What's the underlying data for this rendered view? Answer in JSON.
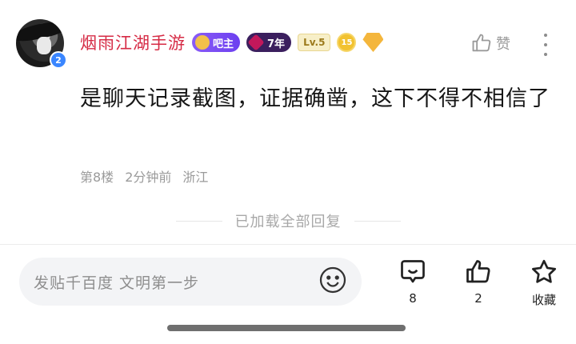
{
  "post": {
    "username": "烟雨江湖手游",
    "avatar_level": "2",
    "badges": {
      "owner": "吧主",
      "years": "7年",
      "level": "Lv.5",
      "coin": "15"
    },
    "like_label": "赞",
    "content": "是聊天记录截图，证据确凿，这下不得不相信了",
    "floor": "第8楼",
    "time": "2分钟前",
    "location": "浙江"
  },
  "loaded_text": "已加载全部回复",
  "bottom_bar": {
    "input_placeholder": "发贴千百度 文明第一步",
    "comment_count": "8",
    "like_count": "2",
    "favorite_label": "收藏"
  },
  "colors": {
    "username": "#d62b45",
    "meta_gray": "#9a9a9a",
    "input_bg": "#f3f4f6"
  }
}
